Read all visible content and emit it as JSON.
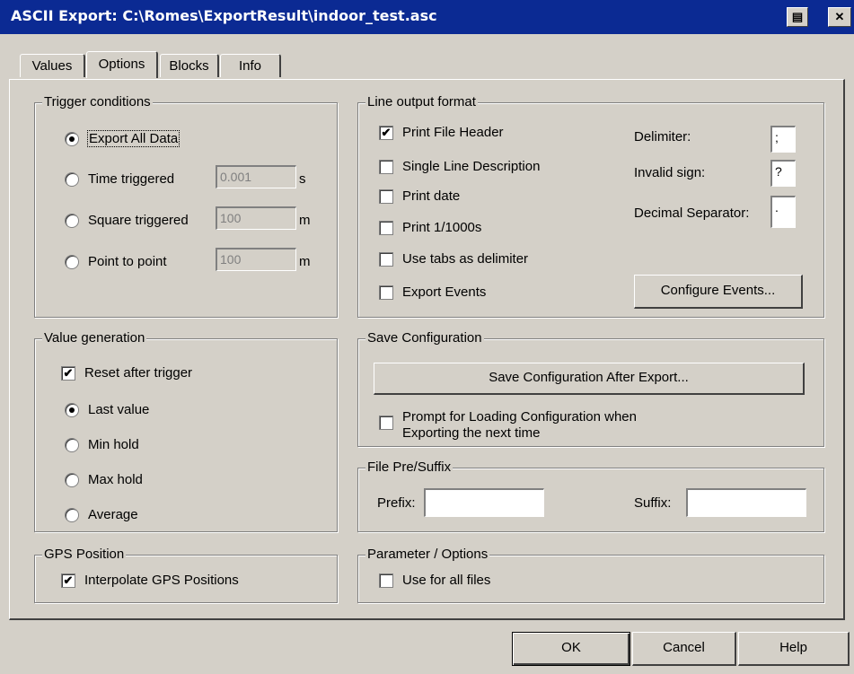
{
  "window": {
    "title": "ASCII Export: C:\\Romes\\ExportResult\\indoor_test.asc",
    "print_glyph": "▤",
    "close_glyph": "✕"
  },
  "tabs": [
    {
      "label": "Values"
    },
    {
      "label": "Options"
    },
    {
      "label": "Blocks"
    },
    {
      "label": "Info"
    }
  ],
  "trigger": {
    "title": "Trigger conditions",
    "options": [
      {
        "label": "Export All Data",
        "selected": true
      },
      {
        "label": "Time triggered",
        "value": "0.001",
        "unit": "s"
      },
      {
        "label": "Square triggered",
        "value": "100",
        "unit": "m"
      },
      {
        "label": "Point to point",
        "value": "100",
        "unit": "m"
      }
    ]
  },
  "value_generation": {
    "title": "Value generation",
    "reset_label": "Reset after trigger",
    "reset_checked": true,
    "options": [
      {
        "label": "Last value",
        "selected": true
      },
      {
        "label": "Min hold"
      },
      {
        "label": "Max hold"
      },
      {
        "label": "Average"
      }
    ]
  },
  "gps": {
    "title": "GPS Position",
    "interpolate_label": "Interpolate GPS Positions",
    "checked": true
  },
  "line_output": {
    "title": "Line output format",
    "checks": [
      {
        "label": "Print File Header",
        "checked": true
      },
      {
        "label": "Single Line Description"
      },
      {
        "label": "Print date"
      },
      {
        "label": "Print 1/1000s"
      },
      {
        "label": "Use tabs as delimiter"
      },
      {
        "label": "Export Events"
      }
    ],
    "delimiter_label": "Delimiter:",
    "delimiter_value": ";",
    "invalid_label": "Invalid sign:",
    "invalid_value": "?",
    "decimal_label": "Decimal Separator:",
    "decimal_value": ".",
    "configure_events_label": "Configure Events..."
  },
  "save_config": {
    "title": "Save Configuration",
    "button_label": "Save Configuration After Export...",
    "prompt_line1": "Prompt for Loading Configuration when",
    "prompt_line2": "Exporting the next time"
  },
  "file_presuffix": {
    "title": "File Pre/Suffix",
    "prefix_label": "Prefix:",
    "prefix_value": "",
    "suffix_label": "Suffix:",
    "suffix_value": ""
  },
  "parameter": {
    "title": "Parameter / Options",
    "use_all_label": "Use for all files"
  },
  "footer": {
    "ok_label": "OK",
    "cancel_label": "Cancel",
    "help_label": "Help"
  },
  "check_glyph": "✔"
}
